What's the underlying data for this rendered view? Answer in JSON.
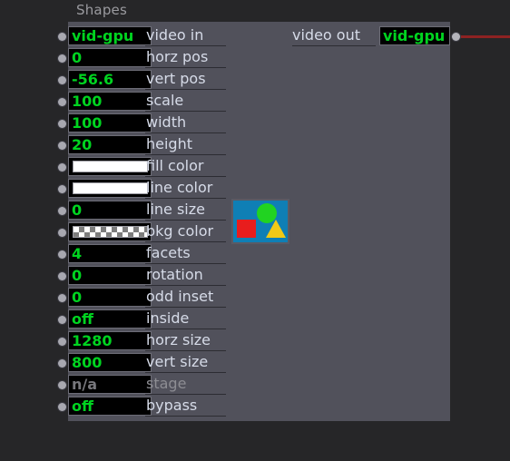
{
  "node": {
    "title": "Shapes",
    "accent_green": "#00d420",
    "panel_color": "#51515b",
    "wire_color": "#8e2222",
    "background_color": "#262628"
  },
  "parameters": [
    {
      "value": "vid-gpu",
      "label": "video in",
      "kind": "text",
      "disabled": false
    },
    {
      "value": "0",
      "label": "horz pos",
      "kind": "number",
      "disabled": false
    },
    {
      "value": "-56.6",
      "label": "vert pos",
      "kind": "number",
      "disabled": false
    },
    {
      "value": "100",
      "label": "scale",
      "kind": "number",
      "disabled": false
    },
    {
      "value": "100",
      "label": "width",
      "kind": "number",
      "disabled": false
    },
    {
      "value": "20",
      "label": "height",
      "kind": "number",
      "disabled": false
    },
    {
      "value": "",
      "label": "fill color",
      "kind": "swatch-white",
      "disabled": false
    },
    {
      "value": "",
      "label": "line color",
      "kind": "swatch-white",
      "disabled": false
    },
    {
      "value": "0",
      "label": "line size",
      "kind": "number",
      "disabled": false
    },
    {
      "value": "",
      "label": "bkg color",
      "kind": "swatch-checker",
      "disabled": false
    },
    {
      "value": "4",
      "label": "facets",
      "kind": "number",
      "disabled": false
    },
    {
      "value": "0",
      "label": "rotation",
      "kind": "number",
      "disabled": false
    },
    {
      "value": "0",
      "label": "odd inset",
      "kind": "number",
      "disabled": false
    },
    {
      "value": "off",
      "label": "inside",
      "kind": "toggle",
      "disabled": false
    },
    {
      "value": "1280",
      "label": "horz size",
      "kind": "number",
      "disabled": false
    },
    {
      "value": "800",
      "label": "vert size",
      "kind": "number",
      "disabled": false
    },
    {
      "value": "n/a",
      "label": "stage",
      "kind": "text",
      "disabled": true
    },
    {
      "value": "off",
      "label": "bypass",
      "kind": "toggle",
      "disabled": false
    }
  ],
  "output": {
    "label": "video out",
    "value": "vid-gpu"
  },
  "preview": {
    "background_color": "#0f7fb5",
    "circle_color": "#21d321",
    "square_color": "#e81d1d",
    "triangle_color": "#f1c916"
  }
}
